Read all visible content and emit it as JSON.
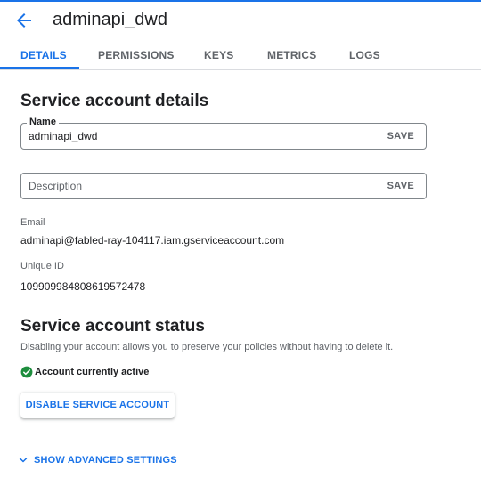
{
  "header": {
    "title": "adminapi_dwd"
  },
  "tabs": [
    {
      "label": "DETAILS",
      "active": true
    },
    {
      "label": "PERMISSIONS"
    },
    {
      "label": "KEYS"
    },
    {
      "label": "METRICS"
    },
    {
      "label": "LOGS"
    }
  ],
  "details": {
    "heading": "Service account details",
    "name_field": {
      "label": "Name",
      "value": "adminapi_dwd",
      "save_label": "SAVE"
    },
    "description_field": {
      "placeholder": "Description",
      "value": "",
      "save_label": "SAVE"
    },
    "email": {
      "label": "Email",
      "value": "adminapi@fabled-ray-104117.iam.gserviceaccount.com"
    },
    "unique_id": {
      "label": "Unique ID",
      "value": "109909984808619572478"
    }
  },
  "status": {
    "heading": "Service account status",
    "description": "Disabling your account allows you to preserve your policies without having to delete it.",
    "state_text": "Account currently active",
    "disable_button": "DISABLE SERVICE ACCOUNT"
  },
  "advanced": {
    "label": "SHOW ADVANCED SETTINGS"
  },
  "colors": {
    "accent": "#1a73e8",
    "success": "#1e8e3e",
    "text": "#202124",
    "secondary": "#5f6368"
  },
  "icons": {
    "back": "arrow-back-icon",
    "status": "check-circle-icon",
    "expand": "chevron-down-icon"
  }
}
